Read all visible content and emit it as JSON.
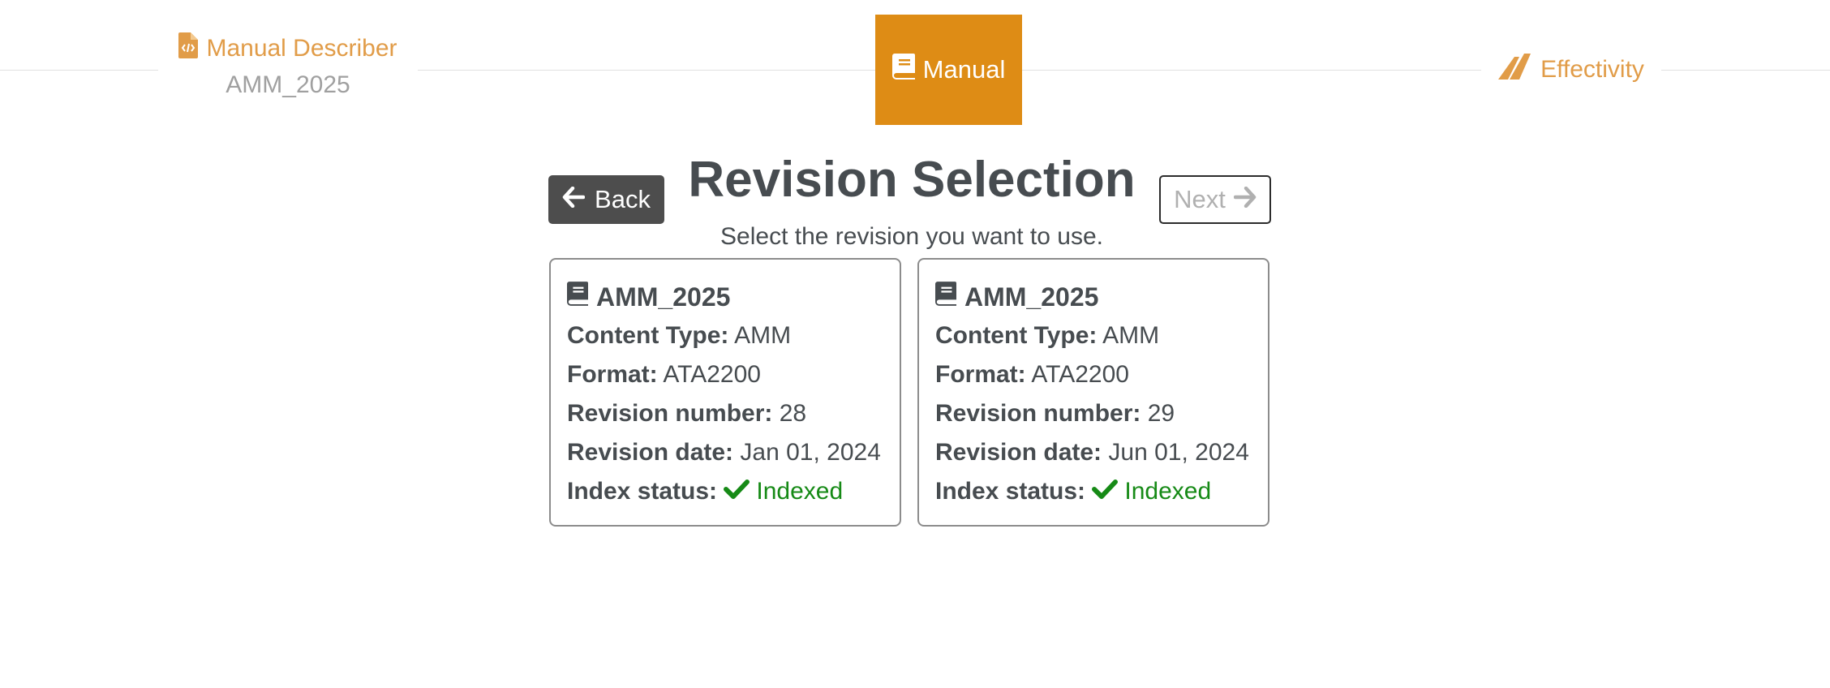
{
  "stepper": {
    "describer": {
      "label": "Manual Describer",
      "value": "AMM_2025",
      "icon": "file-code-icon"
    },
    "manual": {
      "label": "Manual",
      "icon": "book-icon",
      "active": true
    },
    "effectivity": {
      "label": "Effectivity",
      "icon": "plane-tail-icon"
    }
  },
  "header": {
    "title": "Revision Selection",
    "subtitle": "Select the revision you want to use.",
    "back_label": "Back",
    "next_label": "Next"
  },
  "labels": {
    "content_type": "Content Type:",
    "format": "Format:",
    "revision_number": "Revision number:",
    "revision_date": "Revision date:",
    "index_status": "Index status:"
  },
  "revisions": [
    {
      "name": "AMM_2025",
      "content_type": "AMM",
      "format": "ATA2200",
      "revision_number": "28",
      "revision_date": "Jan 01, 2024",
      "index_status": "Indexed"
    },
    {
      "name": "AMM_2025",
      "content_type": "AMM",
      "format": "ATA2200",
      "revision_number": "29",
      "revision_date": "Jun 01, 2024",
      "index_status": "Indexed"
    }
  ],
  "colors": {
    "accent": "#de8c15",
    "accent_text": "#e19c48",
    "success": "#168a16",
    "text": "#474c50"
  }
}
